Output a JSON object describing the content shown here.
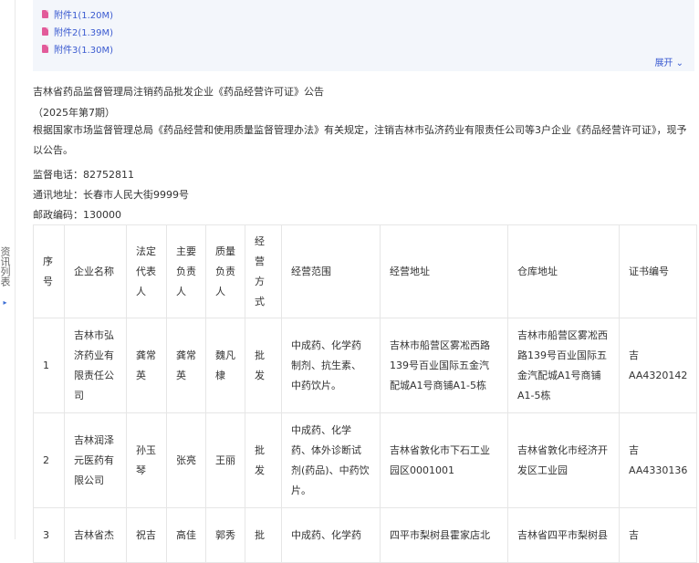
{
  "side_tab": {
    "label": "资讯列表",
    "arrow": "▸"
  },
  "attachments": [
    {
      "label": "附件1(1.20M)"
    },
    {
      "label": "附件2(1.39M)"
    },
    {
      "label": "附件3(1.30M)"
    }
  ],
  "expand_label": "展开 ⌄",
  "notice": {
    "title": "吉林省药品监督管理局注销药品批发企业《药品经营许可证》公告",
    "issue": "（2025年第7期）",
    "body": "根据国家市场监督管理总局《药品经营和使用质量监督管理办法》有关规定，注销吉林市弘济药业有限责任公司等3户企业《药品经营许可证》，现予以公告。",
    "phone": "监督电话：82752811",
    "address": "通讯地址：长春市人民大街9999号",
    "postcode": "邮政编码：130000"
  },
  "table": {
    "headers": [
      "序号",
      "企业名称",
      "法定代表人",
      "主要负责人",
      "质量负责人",
      "经营方式",
      "经营范围",
      "经营地址",
      "仓库地址",
      "证书编号"
    ],
    "rows": [
      {
        "no": "1",
        "company": "吉林市弘济药业有限责任公司",
        "legal_rep": "龚常英",
        "principal": "龚常英",
        "quality": "魏凡棣",
        "mode": "批发",
        "scope": "中成药、化学药制剂、抗生素、中药饮片。",
        "address": "吉林市船营区雾凇西路139号百业国际五金汽配城A1号商铺A1-5栋",
        "warehouse": "吉林市船营区雾凇西路139号百业国际五金汽配城A1号商铺A1-5栋",
        "cert": "吉AA4320142"
      },
      {
        "no": "2",
        "company": "吉林润泽元医药有限公司",
        "legal_rep": "孙玉琴",
        "principal": "张亮",
        "quality": "王丽",
        "mode": "批发",
        "scope": "中成药、化学药、体外诊断试剂(药品)、中药饮片。",
        "address": "吉林省敦化市下石工业园区0001001",
        "warehouse": "吉林省敦化市经济开发区工业园",
        "cert": "吉AA4330136"
      },
      {
        "no": "3",
        "company": "吉林省杰",
        "legal_rep": "祝吉",
        "principal": "高佳",
        "quality": "郭秀",
        "mode": "批",
        "scope": "中成药、化学药",
        "address": "四平市梨树县霍家店北",
        "warehouse": "吉林省四平市梨树县",
        "cert": "吉"
      }
    ]
  }
}
